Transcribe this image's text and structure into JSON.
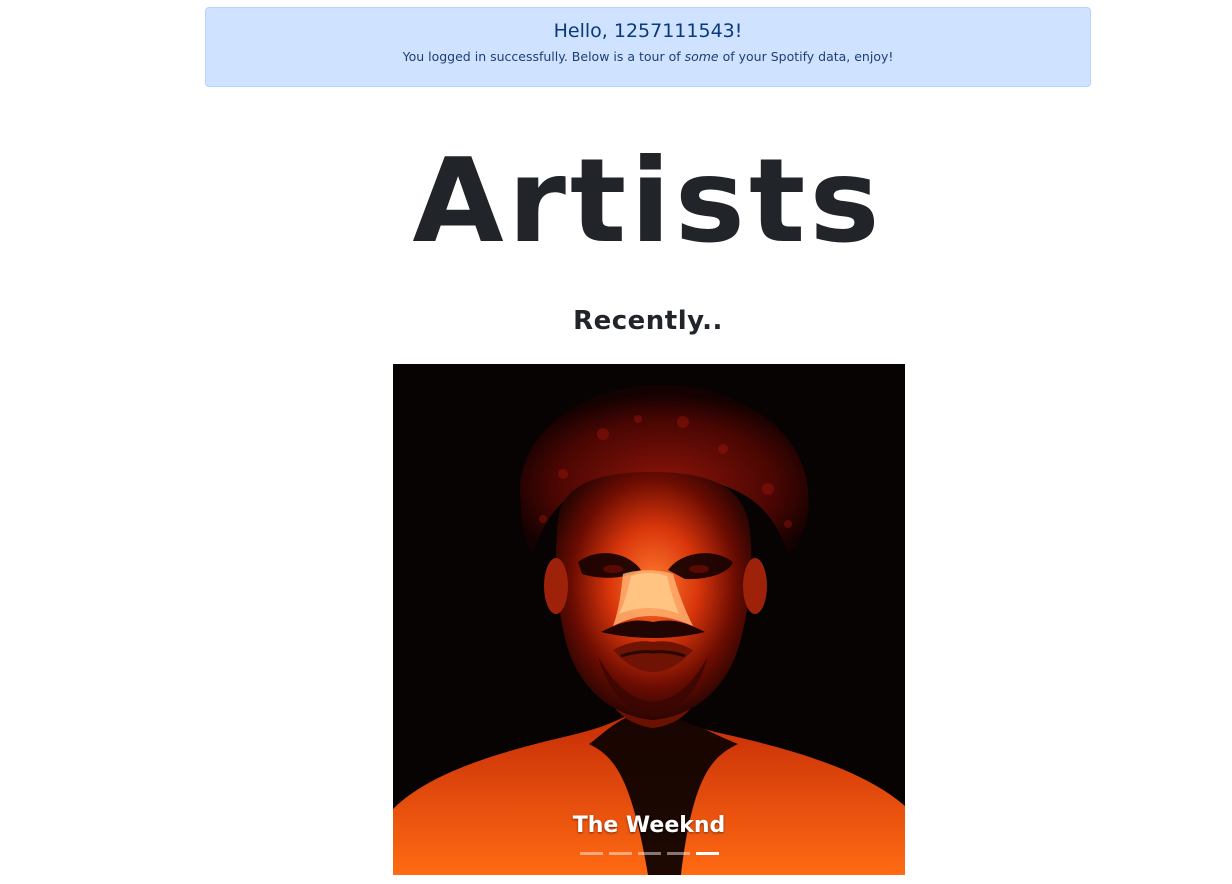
{
  "alert": {
    "greeting": "Hello, 1257111543!",
    "message_before": "You logged in successfully. Below is a tour of ",
    "message_emphasis": "some",
    "message_after": " of your Spotify data, enjoy!"
  },
  "section": {
    "heading": "Artists",
    "subheading": "Recently.."
  },
  "carousel": {
    "current_caption": "The Weeknd",
    "indicators": [
      {
        "active": false
      },
      {
        "active": false
      },
      {
        "active": false
      },
      {
        "active": false
      },
      {
        "active": true
      }
    ]
  },
  "colors": {
    "alert_bg": "#cfe2ff",
    "alert_text": "#0a3a7a",
    "heading": "#212529"
  }
}
